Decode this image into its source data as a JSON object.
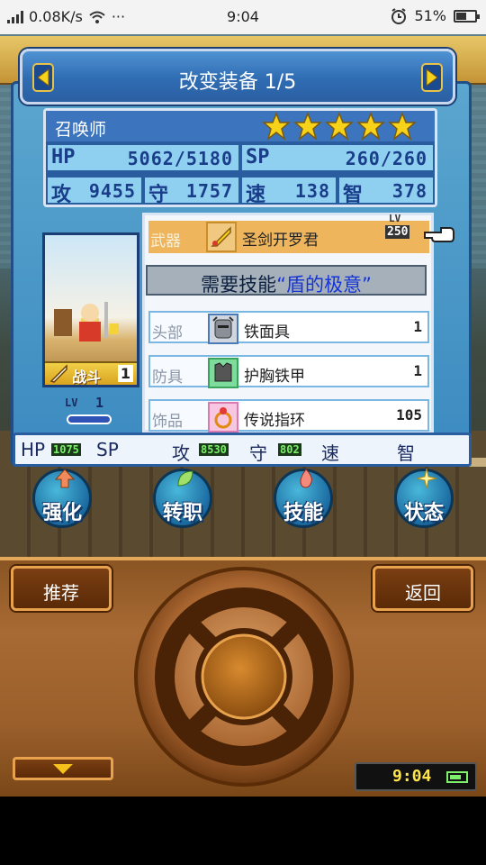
{
  "status_bar": {
    "network_speed": "0.08K/s",
    "more": "···",
    "time": "9:04",
    "battery_percent": "51%",
    "battery_level": 0.51
  },
  "header": {
    "title": "改变装备 1/5"
  },
  "hero": {
    "name": "召唤师",
    "stars": 5,
    "stats": [
      {
        "key": "HP",
        "value": "5062/5180"
      },
      {
        "key": "SP",
        "value": "260/260"
      },
      {
        "key": "攻",
        "value": "9455"
      },
      {
        "key": "守",
        "value": "1757"
      },
      {
        "key": "速",
        "value": "138"
      },
      {
        "key": "智",
        "value": "378"
      }
    ],
    "battle_tag": "战斗",
    "battle_num": "1",
    "level_label": "LV",
    "level": "1"
  },
  "equipment": {
    "weapon": {
      "slot": "武器",
      "name": "圣剑开罗君",
      "lv_label": "LV",
      "lv": "250"
    },
    "skill_banner": {
      "prefix": "需要技能",
      "highlight": "“盾的极意”"
    },
    "items": [
      {
        "slot": "头部",
        "name": "铁面具",
        "qty": "1"
      },
      {
        "slot": "防具",
        "name": "护胸铁甲",
        "qty": "1"
      },
      {
        "slot": "饰品",
        "name": "传说指环",
        "qty": "105"
      }
    ]
  },
  "bottom_strip": {
    "hp_label": "HP",
    "hp_val": "1075",
    "sp_label": "SP",
    "atk_label": "攻",
    "atk_val": "8530",
    "def_label": "守",
    "def_val": "802",
    "spd_label": "速",
    "int_label": "智"
  },
  "actions": [
    {
      "label": "强化",
      "icon": "up-arrow-icon"
    },
    {
      "label": "转职",
      "icon": "leaf-icon"
    },
    {
      "label": "技能",
      "icon": "flame-icon"
    },
    {
      "label": "状态",
      "icon": "sparkle-icon"
    }
  ],
  "controls": {
    "recommend": "推荐",
    "back": "返回"
  },
  "game_clock": "9:04",
  "colors": {
    "panel_blue": "#3b8ac0",
    "title_blue": "#2f6cb3",
    "weapon_row": "#efb55d",
    "wood": "#a86a34",
    "star": "#f6d21b"
  }
}
